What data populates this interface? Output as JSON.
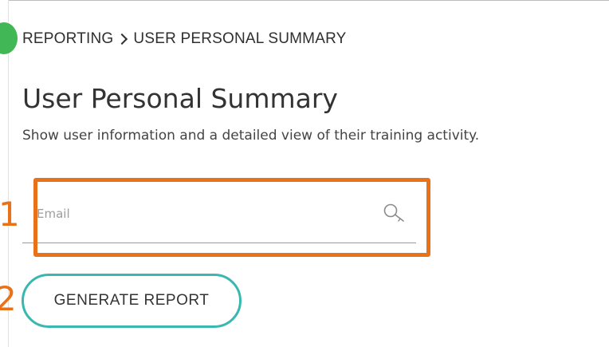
{
  "breadcrumb": {
    "parent": "REPORTING",
    "current": "USER PERSONAL SUMMARY"
  },
  "page": {
    "title": "User Personal Summary",
    "description": "Show user information and a detailed view of their training activity."
  },
  "annotations": {
    "step1": "1",
    "step2": "2",
    "color": "#e8721a"
  },
  "search": {
    "placeholder": "Email",
    "value": "",
    "icon": "search-icon"
  },
  "actions": {
    "generate_label": "GENERATE REPORT",
    "accent": "#3ab8b0"
  },
  "colors": {
    "badge": "#41b855"
  }
}
